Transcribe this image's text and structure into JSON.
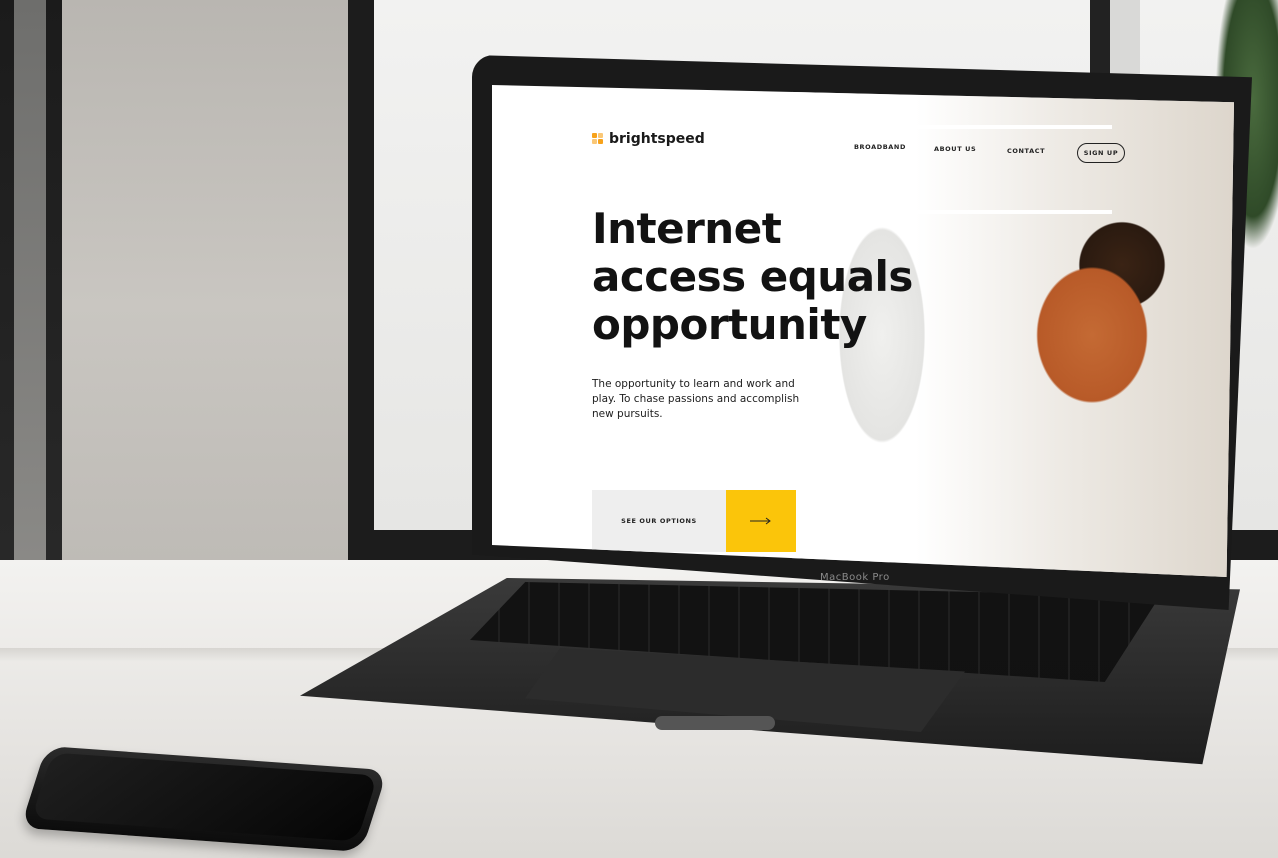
{
  "brand": {
    "name": "brightspeed",
    "accent": "#fbc50a",
    "logo_color": "#f7a21b"
  },
  "nav": {
    "links": [
      "BROADBAND",
      "ABOUT US",
      "CONTACT"
    ],
    "signup": "SIGN UP"
  },
  "hero": {
    "headline_lines": [
      "Internet",
      "access equals",
      "opportunity"
    ],
    "subtext": "The opportunity to learn and work and play. To chase passions and accomplish new pursuits.",
    "cta_label": "SEE OUR OPTIONS",
    "cta_icon": "arrow-right-icon"
  },
  "device": {
    "label": "MacBook Pro"
  }
}
